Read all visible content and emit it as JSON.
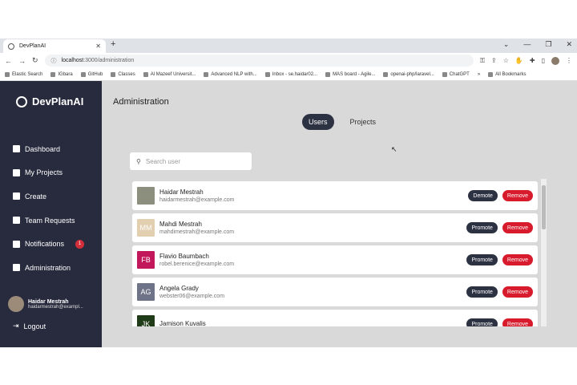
{
  "browser": {
    "tab_title": "DevPlanAI",
    "url_host": "localhost",
    "url_path": ":3000/administration",
    "bookmarks": [
      "Elastic Search",
      "IGbara",
      "GitHub",
      "Classes",
      "Al Mazeef Universit...",
      "Advanced NLP with...",
      "Inbox - se.haidar02...",
      "MAS board - Agile...",
      "openai-php/laravel...",
      "ChatGPT"
    ],
    "all_bookmarks": "All Bookmarks"
  },
  "sidebar": {
    "brand": "DevPlanAI",
    "items": [
      {
        "label": "Dashboard"
      },
      {
        "label": "My Projects"
      },
      {
        "label": "Create"
      },
      {
        "label": "Team Requests"
      },
      {
        "label": "Notifications",
        "badge": "1"
      },
      {
        "label": "Administration"
      }
    ],
    "user_name": "Haidar Mestrah",
    "user_email": "haidarmestrah@exampl...",
    "logout": "Logout"
  },
  "main": {
    "title": "Administration",
    "tabs": [
      "Users",
      "Projects"
    ],
    "search_placeholder": "Search user",
    "users": [
      {
        "name": "Haidar Mestrah",
        "email": "haidarmestrah@example.com",
        "action": "Demote",
        "remove": "Remove",
        "initials": "",
        "color": "#8c8f7e"
      },
      {
        "name": "Mahdi Mestrah",
        "email": "mahdimestrah@example.com",
        "action": "Promote",
        "remove": "Remove",
        "initials": "MM",
        "color": "#e2cfaf"
      },
      {
        "name": "Flavio Baumbach",
        "email": "robel.berenice@example.com",
        "action": "Promote",
        "remove": "Remove",
        "initials": "FB",
        "color": "#c2185b"
      },
      {
        "name": "Angela Grady",
        "email": "webster06@example.com",
        "action": "Promote",
        "remove": "Remove",
        "initials": "AG",
        "color": "#6f7387"
      },
      {
        "name": "Jamison Kuvalis",
        "email": "",
        "action": "Promote",
        "remove": "Remove",
        "initials": "JK",
        "color": "#1f3b17"
      }
    ]
  }
}
